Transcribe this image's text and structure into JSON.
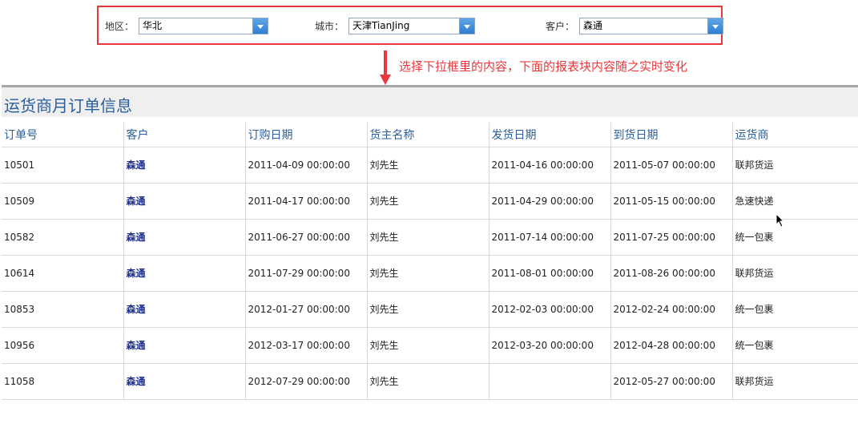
{
  "filters": {
    "region": {
      "label": "地区：",
      "value": "华北"
    },
    "city": {
      "label": "城市：",
      "value": "天津TianJing"
    },
    "customer": {
      "label": "客户：",
      "value": "森通"
    }
  },
  "callout": {
    "text": "选择下拉框里的内容，下面的报表块内容随之实时变化",
    "color": "#e8383d"
  },
  "report": {
    "title": "运货商月订单信息",
    "columns": [
      "订单号",
      "客户",
      "订购日期",
      "货主名称",
      "发货日期",
      "到货日期",
      "运货商"
    ],
    "rows": [
      [
        "10501",
        "森通",
        "2011-04-09 00:00:00",
        "刘先生",
        "2011-04-16 00:00:00",
        "2011-05-07 00:00:00",
        "联邦货运"
      ],
      [
        "10509",
        "森通",
        "2011-04-17 00:00:00",
        "刘先生",
        "2011-04-29 00:00:00",
        "2011-05-15 00:00:00",
        "急速快递"
      ],
      [
        "10582",
        "森通",
        "2011-06-27 00:00:00",
        "刘先生",
        "2011-07-14 00:00:00",
        "2011-07-25 00:00:00",
        "统一包裹"
      ],
      [
        "10614",
        "森通",
        "2011-07-29 00:00:00",
        "刘先生",
        "2011-08-01 00:00:00",
        "2011-08-26 00:00:00",
        "联邦货运"
      ],
      [
        "10853",
        "森通",
        "2012-01-27 00:00:00",
        "刘先生",
        "2012-02-03 00:00:00",
        "2012-02-24 00:00:00",
        "统一包裹"
      ],
      [
        "10956",
        "森通",
        "2012-03-17 00:00:00",
        "刘先生",
        "2012-03-20 00:00:00",
        "2012-04-28 00:00:00",
        "统一包裹"
      ],
      [
        "11058",
        "森通",
        "2012-07-29 00:00:00",
        "刘先生",
        "",
        "2012-05-27 00:00:00",
        "联邦货运"
      ]
    ]
  },
  "colors": {
    "accent": "#2a5e9e",
    "highlight": "#e8383d",
    "customer_text": "#1f2f8a"
  }
}
